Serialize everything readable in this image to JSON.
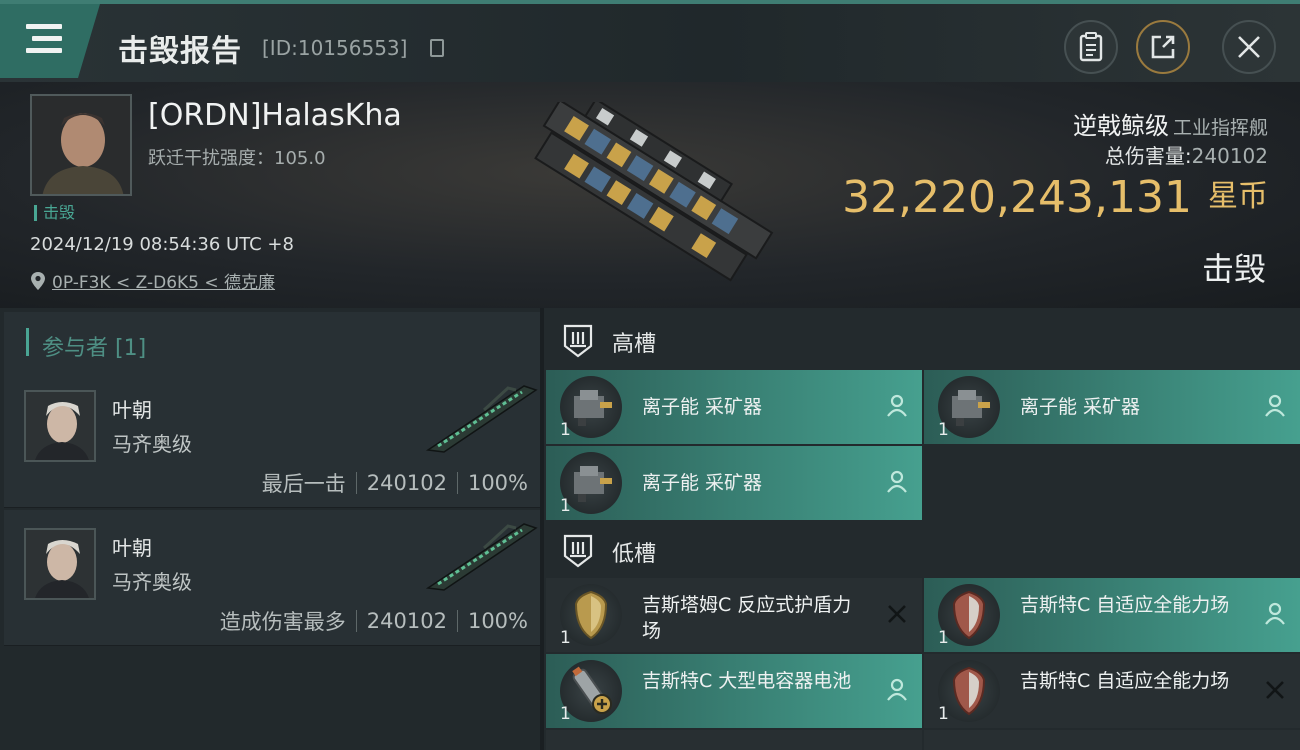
{
  "header": {
    "title": "击毁报告",
    "id_text": "[ID:10156553]"
  },
  "victim": {
    "pilot_name": "[ORDN]HalasKha",
    "warp_scramble": "跃迁干扰强度：105.0",
    "status_tag": "击毁",
    "timestamp": "2024/12/19 08:54:36 UTC +8",
    "location": "0P-F3K < Z-D6K5 < 德克廉",
    "ship_class": "逆戟鲸级",
    "ship_type": "工业指挥舰",
    "total_damage_label": "总伤害量:",
    "total_damage": "240102",
    "isk_value": "32,220,243,131",
    "isk_unit": "星币",
    "outcome": "击毁"
  },
  "participants": {
    "title": "参与者 [1]",
    "items": [
      {
        "name": "叶朝",
        "ship": "马齐奥级",
        "role": "最后一击",
        "damage": "240102",
        "percent": "100%"
      },
      {
        "name": "叶朝",
        "ship": "马齐奥级",
        "role": "造成伤害最多",
        "damage": "240102",
        "percent": "100%"
      }
    ]
  },
  "slots": {
    "high": {
      "title": "高槽",
      "modules": [
        {
          "name": "离子能 采矿器",
          "qty": "1",
          "state": "fitted"
        },
        {
          "name": "离子能 采矿器",
          "qty": "1",
          "state": "fitted"
        },
        {
          "name": "离子能 采矿器",
          "qty": "1",
          "state": "fitted"
        }
      ]
    },
    "low": {
      "title": "低槽",
      "modules": [
        {
          "name": "吉斯塔姆C 反应式护盾力场",
          "qty": "1",
          "state": "destroyed"
        },
        {
          "name": "吉斯特C 自适应全能力场",
          "qty": "1",
          "state": "fitted"
        },
        {
          "name": "吉斯特C 大型电容器电池",
          "qty": "1",
          "state": "fitted"
        },
        {
          "name": "吉斯特C 自适应全能力场",
          "qty": "1",
          "state": "destroyed"
        }
      ]
    }
  },
  "colors": {
    "accent": "#3f7d73",
    "isk": "#e6be6a",
    "fitted_slot": "#3b8578",
    "participants_title": "#4e8f84"
  },
  "icons": {
    "menu": "menu-icon",
    "copy": "copy-icon",
    "clipboard": "clipboard-icon",
    "share": "share-icon",
    "close": "close-icon",
    "location": "location-pin-icon",
    "high_slot": "high-slot-icon",
    "low_slot": "low-slot-icon",
    "fitted": "person-icon",
    "destroyed": "x-icon"
  }
}
